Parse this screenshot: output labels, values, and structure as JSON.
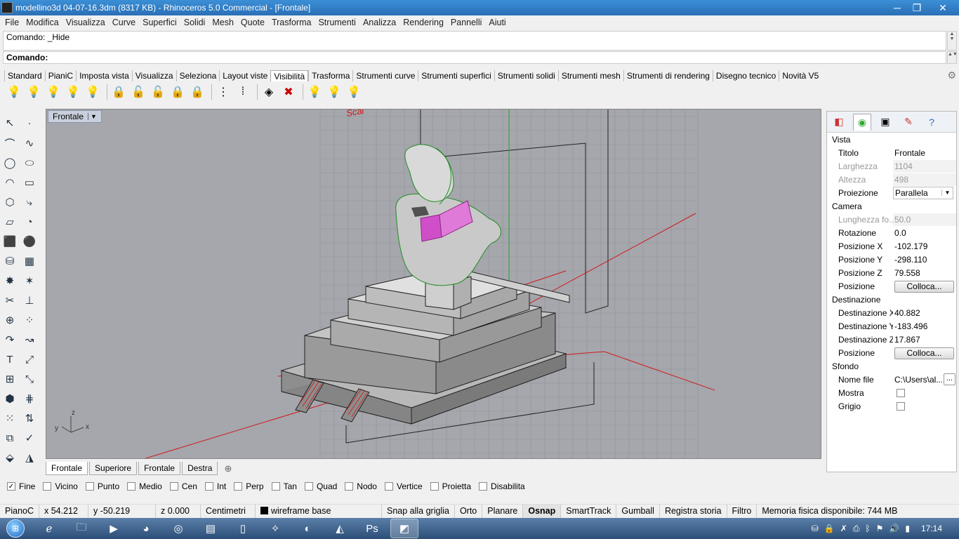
{
  "window": {
    "title": "modellino3d 04-07-16.3dm (8317 KB) - Rhinoceros 5.0 Commercial - [Frontale]",
    "minimize": "─",
    "maximize": "❐",
    "close": "✕"
  },
  "menu": [
    "File",
    "Modifica",
    "Visualizza",
    "Curve",
    "Superfici",
    "Solidi",
    "Mesh",
    "Quote",
    "Trasforma",
    "Strumenti",
    "Analizza",
    "Rendering",
    "Pannelli",
    "Aiuti"
  ],
  "command": {
    "history": "Comando: _Hide",
    "prompt_label": "Comando:",
    "prompt_value": ""
  },
  "toolbar_tabs": [
    "Standard",
    "PianiC",
    "Imposta vista",
    "Visualizza",
    "Seleziona",
    "Layout viste",
    "Visibilità",
    "Trasforma",
    "Strumenti curve",
    "Strumenti superfici",
    "Strumenti solidi",
    "Strumenti mesh",
    "Strumenti di rendering",
    "Disegno tecnico",
    "Novità V5"
  ],
  "toolbar_active": "Visibilità",
  "visibility_tools": [
    "lightbulb-on-icon",
    "lightbulb-icon",
    "lightbulb-selected-icon",
    "lightbulb-swap-icon",
    "lightbulb-multi-icon",
    "lock-icon",
    "unlock-icon",
    "unlock-selected-icon",
    "lock-swap-icon",
    "lock-multi-icon",
    "hide-points-icon",
    "show-points-icon",
    "isolate-icon",
    "hide-in-detail-icon",
    "lightbulb-layer-icon",
    "lightbulb-layer-off-icon",
    "lightbulb-layer-on-icon"
  ],
  "viewport": {
    "label": "Frontale",
    "axis_x": "x",
    "axis_y": "y",
    "axis_z": "z"
  },
  "view_tabs": [
    "Frontale",
    "Superiore",
    "Frontale",
    "Destra"
  ],
  "view_tabs_active": 0,
  "panel": {
    "tab_icons": [
      "layer-icon",
      "color-wheel-icon",
      "display-icon",
      "pencil-icon",
      "help-icon"
    ],
    "section_vista": "Vista",
    "titolo_label": "Titolo",
    "titolo_value": "Frontale",
    "larghezza_label": "Larghezza",
    "larghezza_value": "1104",
    "altezza_label": "Altezza",
    "altezza_value": "498",
    "proiezione_label": "Proiezione",
    "proiezione_value": "Parallela",
    "section_camera": "Camera",
    "lunghezza_label": "Lunghezza fo...",
    "lunghezza_value": "50.0",
    "rotazione_label": "Rotazione",
    "rotazione_value": "0.0",
    "posx_label": "Posizione X",
    "posx_value": "-102.179",
    "posy_label": "Posizione Y",
    "posy_value": "-298.110",
    "posz_label": "Posizione Z",
    "posz_value": "79.558",
    "posizione_label": "Posizione",
    "colloca_label": "Colloca...",
    "section_destinazione": "Destinazione",
    "destx_label": "Destinazione X",
    "destx_value": "40.882",
    "desty_label": "Destinazione Y",
    "desty_value": "-183.496",
    "destz_label": "Destinazione Z",
    "destz_value": "17.867",
    "posizione2_label": "Posizione",
    "colloca2_label": "Colloca...",
    "section_sfondo": "Sfondo",
    "nomefile_label": "Nome file",
    "nomefile_value": "C:\\Users\\al...",
    "browse_label": "...",
    "mostra_label": "Mostra",
    "grigio_label": "Grigio"
  },
  "osnaps": [
    {
      "label": "Fine",
      "checked": true
    },
    {
      "label": "Vicino",
      "checked": false
    },
    {
      "label": "Punto",
      "checked": false
    },
    {
      "label": "Medio",
      "checked": false
    },
    {
      "label": "Cen",
      "checked": false
    },
    {
      "label": "Int",
      "checked": false
    },
    {
      "label": "Perp",
      "checked": false
    },
    {
      "label": "Tan",
      "checked": false
    },
    {
      "label": "Quad",
      "checked": false
    },
    {
      "label": "Nodo",
      "checked": false
    },
    {
      "label": "Vertice",
      "checked": false
    },
    {
      "label": "Proietta",
      "checked": false
    },
    {
      "label": "Disabilita",
      "checked": false
    }
  ],
  "status": {
    "cplane": "PianoC",
    "x": "x 54.212",
    "y": "y -50.219",
    "z": "z 0.000",
    "units": "Centimetri",
    "layer": "wireframe base",
    "snap": "Snap alla griglia",
    "orto": "Orto",
    "planare": "Planare",
    "osnap": "Osnap",
    "smarttrack": "SmartTrack",
    "gumball": "Gumball",
    "history": "Registra storia",
    "filtro": "Filtro",
    "memory": "Memoria fisica disponibile: 744 MB"
  },
  "taskbar": {
    "start": "⊞",
    "apps": [
      "ie-icon",
      "explorer-icon",
      "media-player-icon",
      "firefox-icon",
      "chrome-icon",
      "winrar-icon",
      "notepad-icon",
      "tools-icon",
      "paint-icon",
      "autocad-icon",
      "photoshop-icon",
      "rhino-icon"
    ],
    "active_index": 11,
    "clock": "17:14"
  },
  "colors": {
    "accent": "#2a6fb6",
    "viewport_bg": "#a5a7ad",
    "red_axis": "#d11a1a",
    "green_axis": "#26a126",
    "pink": "#d04fc8"
  }
}
